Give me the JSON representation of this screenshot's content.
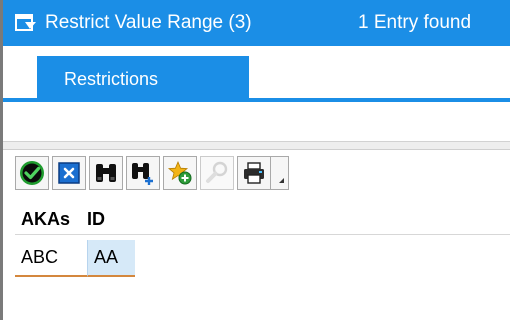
{
  "titlebar": {
    "title": "Restrict Value Range (3)",
    "entries": "1 Entry found"
  },
  "tabs": [
    {
      "label": "Restrictions",
      "selected": true
    }
  ],
  "toolbar": {
    "buttons": [
      {
        "name": "continue-button",
        "icon": "green-check-icon"
      },
      {
        "name": "cancel-button",
        "icon": "blue-x-icon"
      },
      {
        "name": "find-button",
        "icon": "binoculars-icon"
      },
      {
        "name": "find-next-button",
        "icon": "binoculars-plus-icon"
      },
      {
        "name": "add-favorite-button",
        "icon": "star-add-icon"
      },
      {
        "name": "search-help-button",
        "icon": "magnifier-disabled-icon"
      },
      {
        "name": "print-button",
        "icon": "printer-icon"
      }
    ]
  },
  "table": {
    "columns": [
      "AKAs",
      "ID"
    ],
    "rows": [
      [
        "ABC",
        "AA"
      ]
    ]
  },
  "colors": {
    "accent": "#1b8ee6",
    "selection_underline": "#d4873d",
    "selected_cell": "#d6e9f8"
  }
}
